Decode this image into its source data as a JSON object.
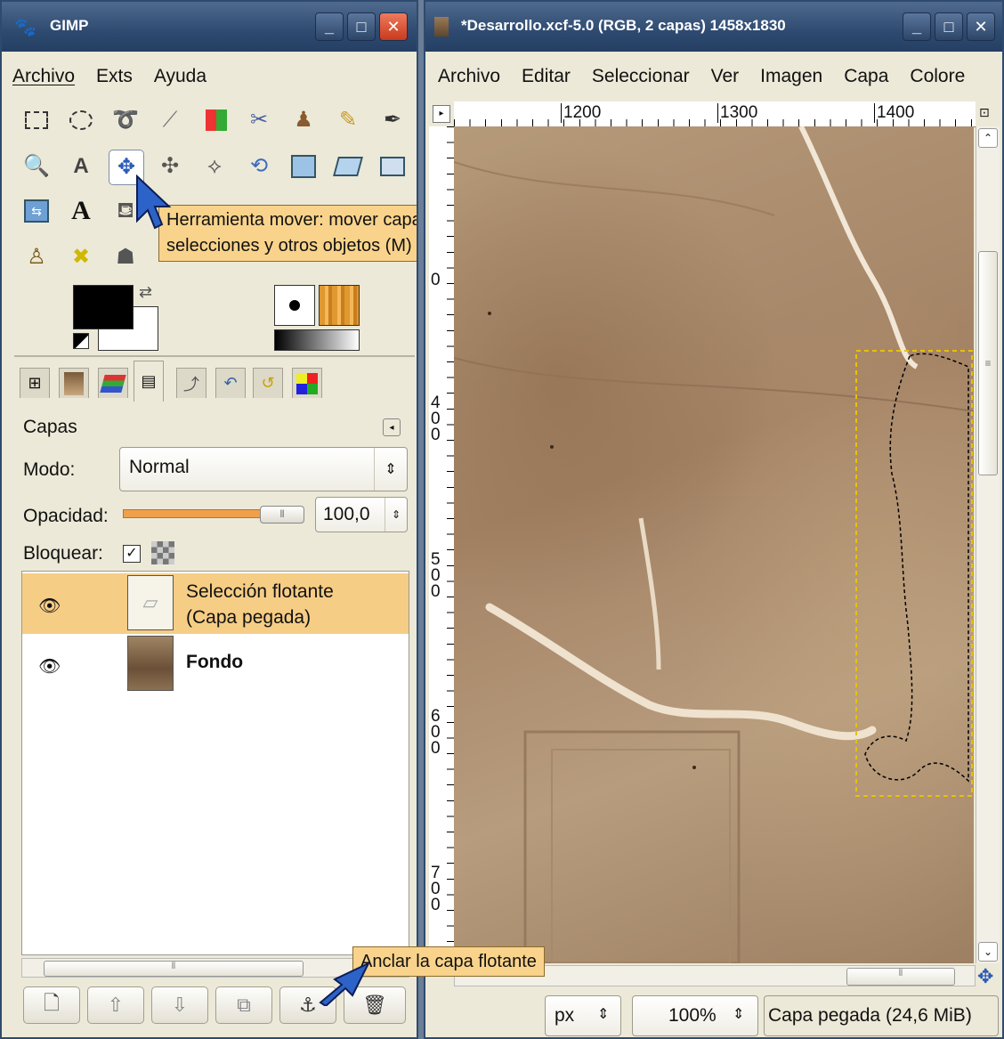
{
  "toolbox": {
    "title": "GIMP",
    "menu": [
      "Archivo",
      "Exts",
      "Ayuda"
    ],
    "tools_row1": [
      "rect-select-icon",
      "ellipse-select-icon",
      "lasso-icon",
      "magic-wand-icon",
      "color-select-icon",
      "scissors-icon",
      "foreground-select-icon",
      "paths-icon",
      "color-picker-icon"
    ],
    "tools_row2": [
      "zoom-icon",
      "measure-icon",
      "move-icon",
      "align-icon",
      "crop-icon",
      "rotate-icon",
      "scale-icon",
      "shear-icon",
      "perspective-icon"
    ],
    "tools_row3": [
      "flip-icon",
      "text-icon",
      "bucket-fill-icon"
    ],
    "tools_row4": [
      "clone-icon",
      "heal-icon",
      "smudge-icon"
    ],
    "move_tooltip_line1": "Herramienta mover: mover capas,",
    "move_tooltip_line2": "selecciones y otros objetos  (M)"
  },
  "layers": {
    "title": "Capas",
    "mode_label": "Modo:",
    "mode_value": "Normal",
    "opacity_label": "Opacidad:",
    "opacity_value": "100,0",
    "opacity_fraction": 1.0,
    "lock_label": "Bloquear:",
    "lock_checked": true,
    "items": [
      {
        "line1": "Selección flotante",
        "line2": "(Capa pegada)",
        "selected": true
      },
      {
        "line1": "Fondo",
        "line2": "",
        "selected": false
      }
    ],
    "anchor_tooltip": "Anclar la capa flotante"
  },
  "image_window": {
    "title": "*Desarrollo.xcf-5.0 (RGB, 2 capas) 1458x1830",
    "menu": [
      "Archivo",
      "Editar",
      "Seleccionar",
      "Ver",
      "Imagen",
      "Capa",
      "Colore"
    ],
    "ruler_h": [
      "1200",
      "1300",
      "1400"
    ],
    "ruler_v": [
      "0",
      "400",
      "500",
      "600",
      "700"
    ],
    "unit": "px",
    "zoom": "100%",
    "status": "Capa pegada (24,6 MiB)"
  },
  "colors": {
    "titlebar": "#2e4a70",
    "selected_layer": "#f6cd85",
    "tooltip_bg": "#f9d38b",
    "opacity_bar": "#f0a04b"
  }
}
